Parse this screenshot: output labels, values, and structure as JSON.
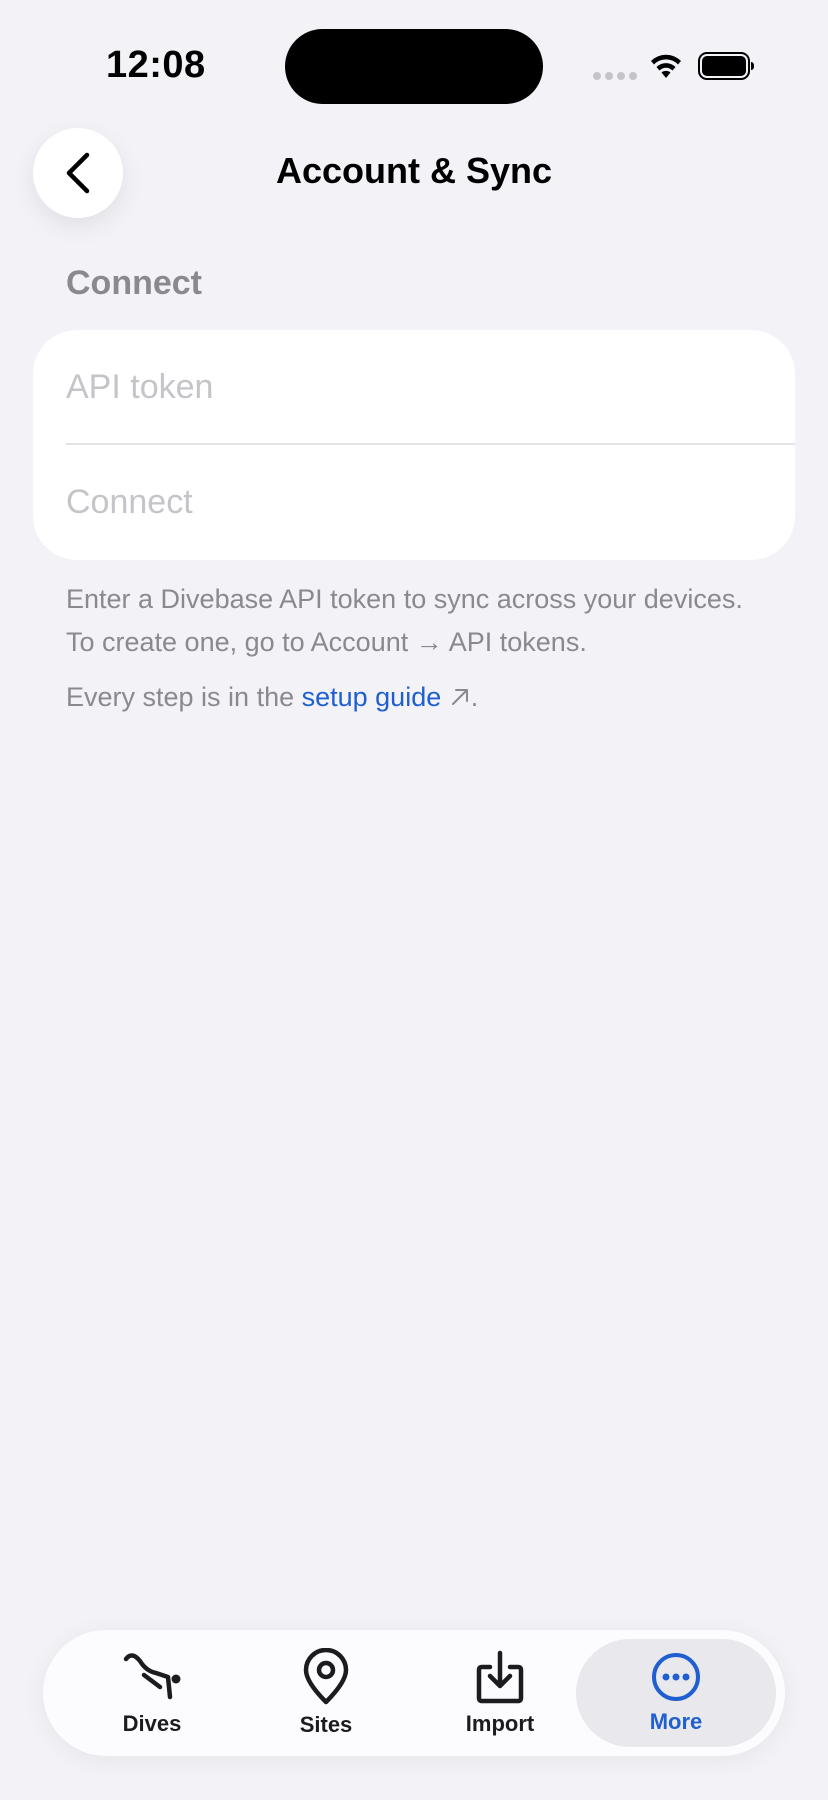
{
  "status_bar": {
    "time": "12:08"
  },
  "nav": {
    "title": "Account & Sync"
  },
  "section": {
    "header": "Connect"
  },
  "form": {
    "token_placeholder": "API token",
    "token_value": "",
    "connect_label": "Connect"
  },
  "footer": {
    "description": "Enter a Divebase API token to sync across your devices. To create one, go to Account → API tokens.",
    "guide_prefix": "Every step is in the ",
    "guide_link": "setup guide",
    "guide_suffix": "."
  },
  "tabs": [
    {
      "label": "Dives",
      "icon": "diver-icon"
    },
    {
      "label": "Sites",
      "icon": "location-pin-icon"
    },
    {
      "label": "Import",
      "icon": "import-icon"
    },
    {
      "label": "More",
      "icon": "more-icon"
    }
  ],
  "colors": {
    "background": "#f2f2f7",
    "card": "#ffffff",
    "accent": "#1f5fcf",
    "secondary_text": "#8a8a8e",
    "placeholder": "#c5c5c9"
  }
}
